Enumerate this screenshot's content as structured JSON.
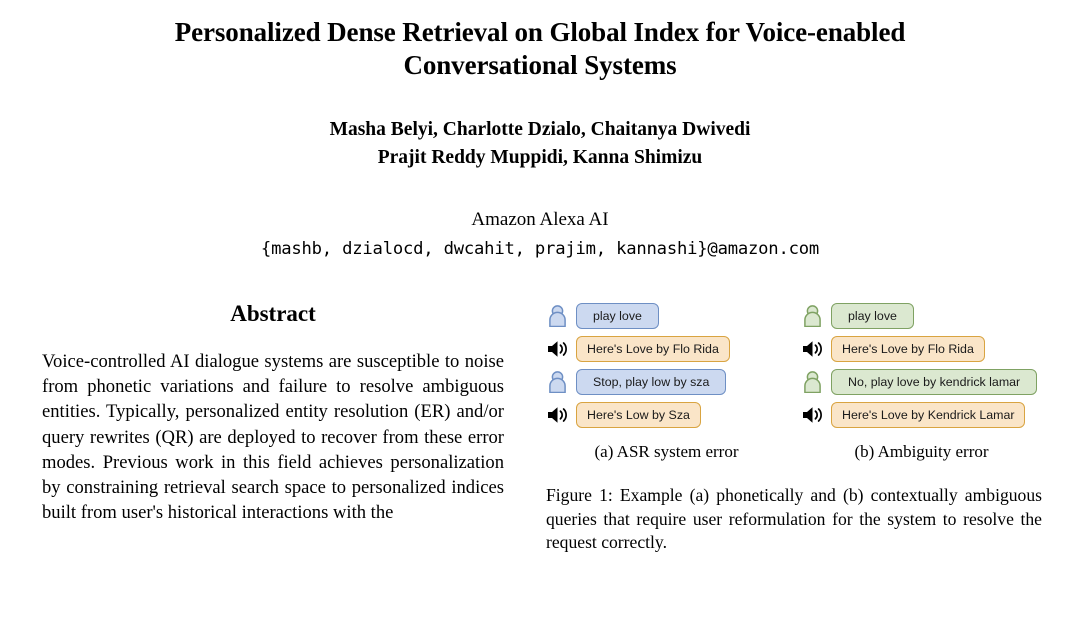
{
  "paper": {
    "title": "Personalized Dense Retrieval on Global Index for Voice-enabled Conversational Systems",
    "authors_line_1": "Masha Belyi, Charlotte Dzialo, Chaitanya Dwivedi",
    "authors_line_2": "Prajit Reddy Muppidi, Kanna Shimizu",
    "affiliation": "Amazon Alexa AI",
    "emails": "{mashb, dzialocd, dwcahit, prajim, kannashi}@amazon.com"
  },
  "abstract": {
    "heading": "Abstract",
    "text": "Voice-controlled AI dialogue systems are susceptible to noise from phonetic variations and failure to resolve ambiguous entities. Typically, personalized entity resolution (ER) and/or query rewrites (QR) are deployed to recover from these error modes. Previous work in this field achieves personalization by constraining retrieval search space to personalized indices built from user's historical interactions with the"
  },
  "figure": {
    "caption": "Figure 1: Example (a) phonetically and (b) contextually ambiguous queries that require user reformulation for the system to resolve the request correctly.",
    "panels": [
      {
        "subcaption": "(a) ASR system error",
        "user_bubble_style": "user-blue",
        "turns": [
          {
            "role": "user",
            "icon": "person-icon",
            "text": "play love"
          },
          {
            "role": "system",
            "icon": "speaker-icon",
            "text": "Here's Love by Flo Rida"
          },
          {
            "role": "user",
            "icon": "person-icon",
            "text": "Stop, play low by sza"
          },
          {
            "role": "system",
            "icon": "speaker-icon",
            "text": "Here's Low by Sza"
          }
        ]
      },
      {
        "subcaption": "(b) Ambiguity error",
        "user_bubble_style": "user-green",
        "turns": [
          {
            "role": "user",
            "icon": "person-icon",
            "text": "play love"
          },
          {
            "role": "system",
            "icon": "speaker-icon",
            "text": "Here's Love by Flo Rida"
          },
          {
            "role": "user",
            "icon": "person-icon",
            "text": "No, play love by kendrick lamar"
          },
          {
            "role": "system",
            "icon": "speaker-icon",
            "text": "Here's Love by Kendrick Lamar"
          }
        ]
      }
    ]
  },
  "colors": {
    "user_blue_fill": "#ccd9f0",
    "user_blue_stroke": "#6e8fc4",
    "user_green_fill": "#dbe8d0",
    "user_green_stroke": "#7fa263",
    "system_fill": "#fae5c8",
    "system_stroke": "#d9a441",
    "speaker_icon": "#000000"
  }
}
